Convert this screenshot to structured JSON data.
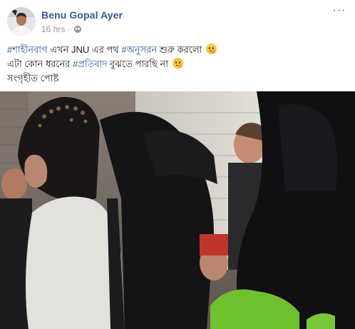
{
  "post": {
    "author": "Benu Gopal Ayer",
    "time": "16 hrs",
    "separator": "·",
    "privacy_icon": "globe-icon",
    "more_icon": "more-options-icon",
    "more_label": "···",
    "text": {
      "line1": {
        "tag1": "#শাহীনবাগ",
        "mid1": " এখন JNU এর পথ ",
        "tag2": "#অনুসরন",
        "end": " শুরু করলো"
      },
      "line2": {
        "start": "এটা কোন ধরনের ",
        "tag": "#প্রতিবাদ",
        "end": " বুঝতে পারছি না"
      },
      "line3": "সংগৃহীত পোষ্ট"
    },
    "emoji_icon": "thinking-face-icon"
  },
  "colors": {
    "link": "#385898",
    "text": "#1d2129",
    "meta": "#90949c"
  }
}
